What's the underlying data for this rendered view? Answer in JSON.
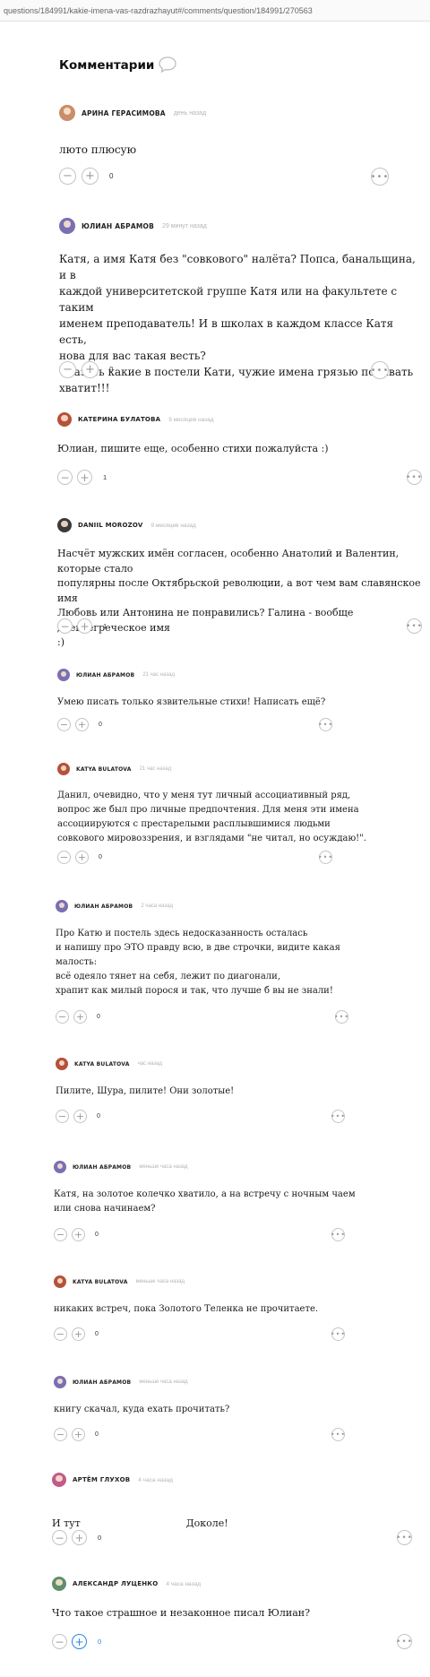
{
  "url": "questions/184991/kakie-imena-vas-razdrazhayut#/comments/question/184991/270563",
  "heading": "Комментарии",
  "colors": {
    "accent": "#2a85e6",
    "muted_border": "#c4c4c4",
    "time": "#b5b5b5"
  },
  "icons": {
    "comments": "speech-bubble-icon",
    "minus": "minus-icon",
    "plus": "plus-icon",
    "more": "ellipsis-icon"
  },
  "comments": [
    {
      "author": "АРИНА ГЕРАСИМОВА",
      "time": "день назад",
      "text": "люто плюсую",
      "score": "0",
      "avatar_color": "#c98d6b"
    },
    {
      "author": "ЮЛИАН АБРАМОВ",
      "time": "29 минут назад",
      "text": "Катя, а имя Катя без \"совкового\" налёта? Попса, банальщина, и в\nкаждой университетской группе Катя или на факультете с таким\nименем преподаватель! И в школах в каждом классе Катя есть,\nнова для вас такая весть?\nСказать какие в постели Кати, чужие имена грязью поливать\nхватит!!!",
      "score": "0",
      "avatar_color": "#7a6fb0"
    },
    {
      "author": "КАТЕРИНА БУЛАТОВА",
      "time": "9 месяцев назад",
      "text": "Юлиан, пишите еще, особенно стихи пожалуйста :)",
      "score": "1",
      "avatar_color": "#b5523a"
    },
    {
      "author": "DANIIL MOROZOV",
      "time": "9 месяцев назад",
      "text": "Насчёт мужских имён согласен, особенно Анатолий и Валентин, которые стало\nпопулярны после Октябрьской революции, а вот чем вам славянское имя\nЛюбовь или Антонина не понравились? Галина - вообще древнегреческое имя\n:)",
      "score": "1",
      "avatar_color": "#3a3a3a"
    },
    {
      "author": "ЮЛИАН АБРАМОВ",
      "time": "21 час назад",
      "text": "Умею писать только язвительные стихи! Написать ещё?",
      "score": "0",
      "avatar_color": "#7a6fb0"
    },
    {
      "author": "KATYA BULATOVA",
      "time": "21 час назад",
      "text": "Данил, очевидно, что у меня тут личный ассоциативный ряд,\nвопрос же был про личные предпочтения. Для меня эти имена\nассоциируются с престарелыми расплывшимися людьми\nсовкового мировоззрения, и взглядами \"не читал, но осуждаю!\".",
      "score": "0",
      "avatar_color": "#b5523a"
    },
    {
      "author": "ЮЛИАН АБРАМОВ",
      "time": "2 часа назад",
      "text": "Про Катю и постель здесь недосказанность осталась\nи напишу про ЭТО правду всю, в две строчки, видите какая\nмалость:\nвсё одеяло тянет на себя, лежит по диагонали,\nхрапит как милый порося и так, что лучше б вы не знали!",
      "score": "0",
      "avatar_color": "#7a6fb0"
    },
    {
      "author": "KATYA BULATOVA",
      "time": "час назад",
      "text": "Пилите, Шура, пилите! Они золотые!",
      "score": "0",
      "avatar_color": "#b5523a"
    },
    {
      "author": "ЮЛИАН АБРАМОВ",
      "time": "меньше часа назад",
      "text": "Катя, на золотое колечко хватило, а на встречу с ночным чаем\nили снова начинаем?",
      "score": "0",
      "avatar_color": "#7a6fb0"
    },
    {
      "author": "KATYA BULATOVA",
      "time": "меньше часа назад",
      "text": "никаких встреч, пока Золотого Теленка не прочитаете.",
      "score": "0",
      "avatar_color": "#b5523a"
    },
    {
      "author": "ЮЛИАН АБРАМОВ",
      "time": "меньше часа назад",
      "text": "книгу скачал, куда ехать прочитать?",
      "score": "0",
      "avatar_color": "#7a6fb0"
    },
    {
      "author": "АРТЁМ ГЛУХОВ",
      "time": "4 часа назад",
      "text": "И тут",
      "text_b": "Доколе!",
      "score": "0",
      "avatar_color": "#c15b8a"
    },
    {
      "author": "АЛЕКСАНДР ЛУЦЕНКО",
      "time": "4 часа назад",
      "text": "Что такое страшное и незаконное писал Юлиан?",
      "score": "0",
      "avatar_color": "#5f8f6a",
      "plus_active": true
    }
  ]
}
